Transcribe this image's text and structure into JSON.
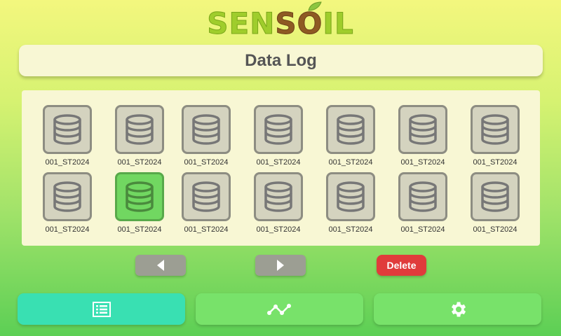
{
  "app": {
    "logo": {
      "left": "SEN",
      "middle": "S",
      "o": "O",
      "right": "IL"
    }
  },
  "header": {
    "title": "Data Log"
  },
  "files": [
    {
      "name": "001_ST2024",
      "selected": false
    },
    {
      "name": "001_ST2024",
      "selected": false
    },
    {
      "name": "001_ST2024",
      "selected": false
    },
    {
      "name": "001_ST2024",
      "selected": false
    },
    {
      "name": "001_ST2024",
      "selected": false
    },
    {
      "name": "001_ST2024",
      "selected": false
    },
    {
      "name": "001_ST2024",
      "selected": false
    },
    {
      "name": "001_ST2024",
      "selected": false
    },
    {
      "name": "001_ST2024",
      "selected": true
    },
    {
      "name": "001_ST2024",
      "selected": false
    },
    {
      "name": "001_ST2024",
      "selected": false
    },
    {
      "name": "001_ST2024",
      "selected": false
    },
    {
      "name": "001_ST2024",
      "selected": false
    },
    {
      "name": "001_ST2024",
      "selected": false
    }
  ],
  "controls": {
    "prev_icon": "chevron-left-icon",
    "next_icon": "chevron-right-icon",
    "delete_label": "Delete"
  },
  "tabs": [
    {
      "icon": "list-icon",
      "active": true
    },
    {
      "icon": "graph-icon",
      "active": false
    },
    {
      "icon": "gear-icon",
      "active": false
    }
  ],
  "colors": {
    "accent_active_tab": "#39e0b2",
    "inactive_tab": "#78e26a",
    "selected_file": "#71d761",
    "delete": "#e03b3b"
  }
}
